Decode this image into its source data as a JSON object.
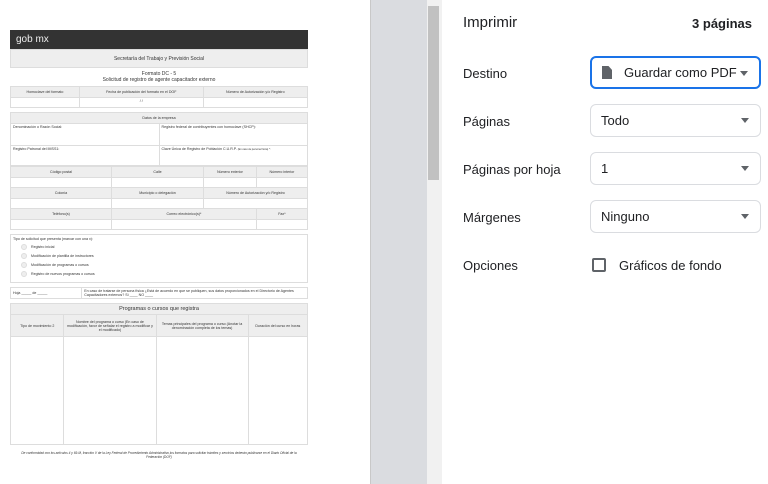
{
  "document": {
    "logo": "gob mx",
    "agency": "Secretaría del Trabajo y Previsión Social",
    "format": "Formato DC - 5",
    "subtitle": "Solicitud de registro de agente capacitador externo",
    "header_cols": [
      "Homoclave del formato",
      "Fecha de publicación del formato en el DOF",
      "Número de Autorización y/o Registro"
    ],
    "date_value": "/ /",
    "company_section": "Datos de la empresa",
    "razon_social": "Denominación o Razón Social:",
    "rfc": "Registro federal de contribuyentes con homoclave (SHCP):",
    "imss": "Registro Patronal del IMSS1:",
    "curp": "Clave Única de Registro de Población C.U.R.P.",
    "curp_note": "(En caso de persona física) *:",
    "addr1": [
      "Código postal",
      "Calle",
      "Número exterior",
      "Número interior"
    ],
    "addr2": [
      "Colonia",
      "Municipio o delegación",
      "Número de Autorización y/o Registro"
    ],
    "addr3": [
      "Teléfono(s)",
      "Correo electrónico(s)*",
      "Fax*"
    ],
    "request_type_label": "Tipo de solicitud que presenta (marcar con una x):",
    "request_types": [
      "Registro inicial",
      "Modificación de plantilla de instructores",
      "Modificación de programas o cursos",
      "Registro de nuevos programas o cursos"
    ],
    "hoja": "Hoja _____ de _____",
    "consent": "En caso de tratarse de persona física ¿Está de acuerdo en que se publiquen, sus datos proporcionados en el Directorio de Agentes Capacitadores externos?   Sí ____ NO ____",
    "programs_title": "Programas o cursos que registra",
    "program_cols": [
      "Tipo de movimiento 2",
      "Nombre del programa o curso (En caso de modificación, favor de señalar el registro a modificar y el modificado)",
      "Temas principales del programa o curso (Anotar la denominación completa de los temas)",
      "Duración del curso en horas"
    ],
    "footer": "De conformidad con los artículos 4 y 69-M, fracción V de la Ley Federal de Procedimiento Administrativo,los formatos para solicitar trámites y servicios deberán publicarse en el Diario Oficial de la Federación (DOF)"
  },
  "panel": {
    "title": "Imprimir",
    "page_count": "3 páginas",
    "destination_label": "Destino",
    "destination_value": "Guardar como PDF",
    "pages_label": "Páginas",
    "pages_value": "Todo",
    "per_sheet_label": "Páginas por hoja",
    "per_sheet_value": "1",
    "margins_label": "Márgenes",
    "margins_value": "Ninguno",
    "options_label": "Opciones",
    "background_graphics": "Gráficos de fondo",
    "background_graphics_checked": false,
    "accent": "#1a73e8"
  }
}
